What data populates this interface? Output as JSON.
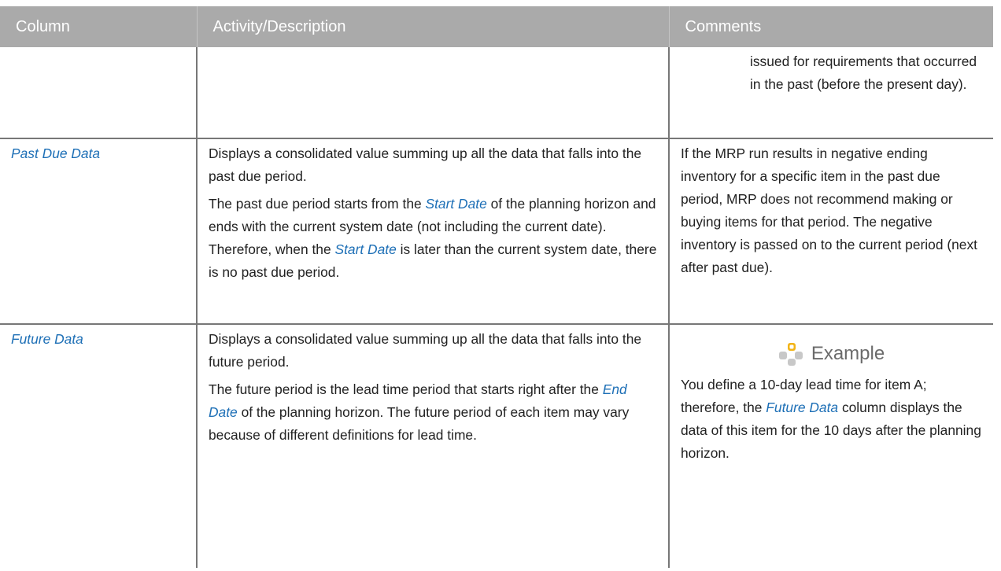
{
  "table": {
    "headers": [
      "Column",
      "Activity/Description",
      "Comments"
    ],
    "rows": [
      {
        "column": "",
        "description": [],
        "comments": [
          "issued for requirements that occurred in the past (before the present day)."
        ]
      },
      {
        "column": "Past Due Data",
        "description": [
          {
            "text": "Displays a consolidated value summing up all the data that falls into the past due period."
          },
          {
            "before": "The past due period starts from the ",
            "ref1": "Start Date",
            "middle": " of the planning horizon and ends with the current system date (not including the current date). Therefore, when the ",
            "ref2": "Start Date",
            "after": " is later than the current system date, there is no past due period."
          }
        ],
        "comments": [
          "If the MRP run results in negative ending inventory for a specific item in the past due period, MRP does not recommend making or buying items for that period. The negative inventory is passed on to the current period (next after past due)."
        ]
      },
      {
        "column": "Future Data",
        "description": [
          {
            "text": "Displays a consolidated value summing up all the data that falls into the future period."
          },
          {
            "before": "The future period is the lead time period that starts right after the ",
            "ref1": "End Date",
            "after": " of the planning horizon. The future period of each item may vary because of different definitions for lead time."
          }
        ],
        "example_label": "Example",
        "example_icon": "example-icon",
        "comments_example": {
          "before": "You define a 10-day lead time for item A; therefore, the ",
          "ref": "Future Data",
          "after": " column displays the data of this item for the 10 days after the planning horizon."
        }
      }
    ]
  },
  "colors": {
    "header_bg": "#aaaaaa",
    "link": "#1d6fb6",
    "icon_orange": "#f2b418",
    "icon_gray": "#c8c8c8"
  }
}
